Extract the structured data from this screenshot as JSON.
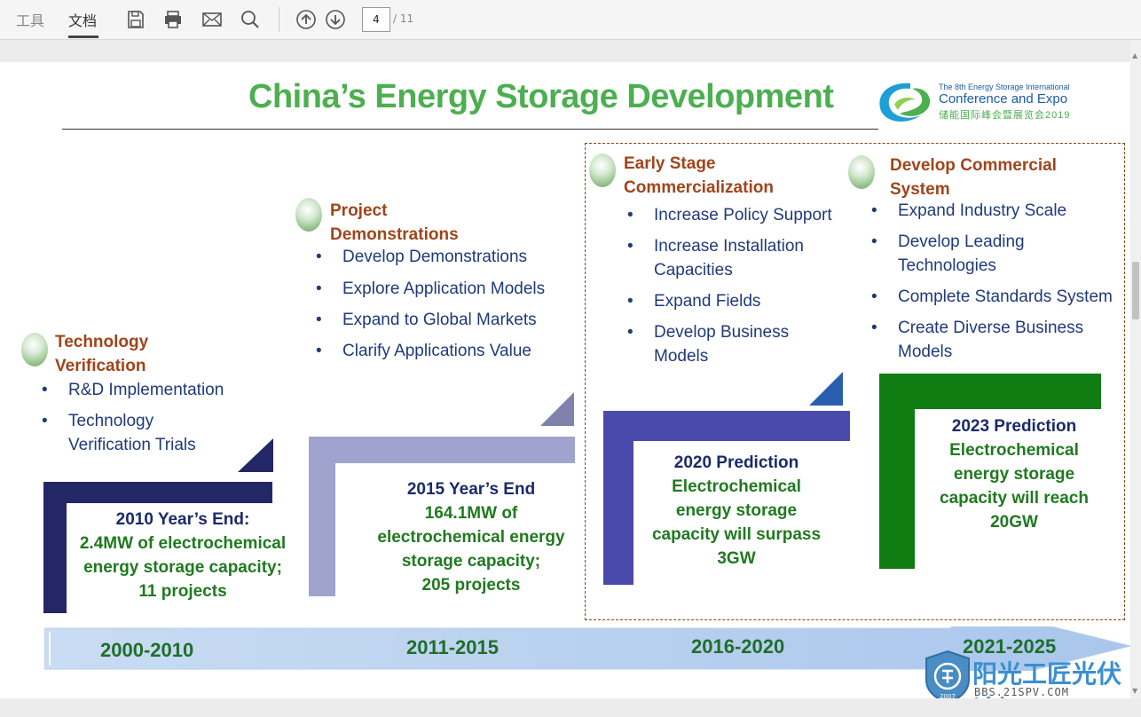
{
  "toolbar": {
    "tab_tools": "工具",
    "tab_document": "文档",
    "page_current": "4",
    "page_total": "/ 11",
    "icons": [
      "save-icon",
      "print-icon",
      "email-icon",
      "search-icon",
      "page-up-icon",
      "page-down-icon"
    ]
  },
  "slide": {
    "title": "China’s Energy Storage Development",
    "logo": {
      "line1": "The 8th Energy Storage International",
      "line2": "Conference and Expo",
      "line3": "储能国际峰会暨展览会2019"
    },
    "stages": [
      {
        "heading": [
          "Technology",
          "Verification"
        ],
        "bullets": [
          "R&D Implementation",
          "Technology Verification Trials"
        ],
        "year_head": "2010 Year’s End:",
        "year_body": [
          "2.4MW of electrochemical",
          "energy storage capacity;",
          "11 projects"
        ],
        "period": "2000-2010"
      },
      {
        "heading": [
          "Project",
          "Demonstrations"
        ],
        "bullets": [
          "Develop Demonstrations",
          "Explore Application Models",
          "Expand to Global Markets",
          "Clarify Applications Value"
        ],
        "year_head": "2015 Year’s End",
        "year_body": [
          "164.1MW of",
          "electrochemical energy",
          "storage capacity;",
          "205 projects"
        ],
        "period": "2011-2015"
      },
      {
        "heading": [
          "Early Stage",
          "Commercialization"
        ],
        "bullets": [
          "Increase Policy Support",
          "Increase Installation Capacities",
          "Expand Fields",
          "Develop Business Models"
        ],
        "year_head": "2020 Prediction",
        "year_body": [
          "Electrochemical",
          "energy storage",
          "capacity will surpass",
          "3GW"
        ],
        "period": "2016-2020"
      },
      {
        "heading": [
          "Develop Commercial",
          "System"
        ],
        "bullets": [
          "Expand Industry Scale",
          "Develop Leading Technologies",
          "Complete Standards System",
          "Create Diverse Business Models"
        ],
        "year_head": "2023 Prediction",
        "year_body": [
          "Electrochemical",
          "energy storage",
          "capacity will reach",
          "20GW"
        ],
        "period": "2021-2025"
      }
    ],
    "colors": {
      "title": "#4caf50",
      "heading": "#a0441a",
      "bullet": "#1f3a7a",
      "bar1": "#242766",
      "bar2": "#9fa3cd",
      "bar3": "#4a4aad",
      "bar4": "#0f7d12"
    }
  },
  "watermark": {
    "text": "阳光工匠光伏论坛",
    "sub": "BBS.21SPV.COM",
    "badge_year": "2007"
  }
}
